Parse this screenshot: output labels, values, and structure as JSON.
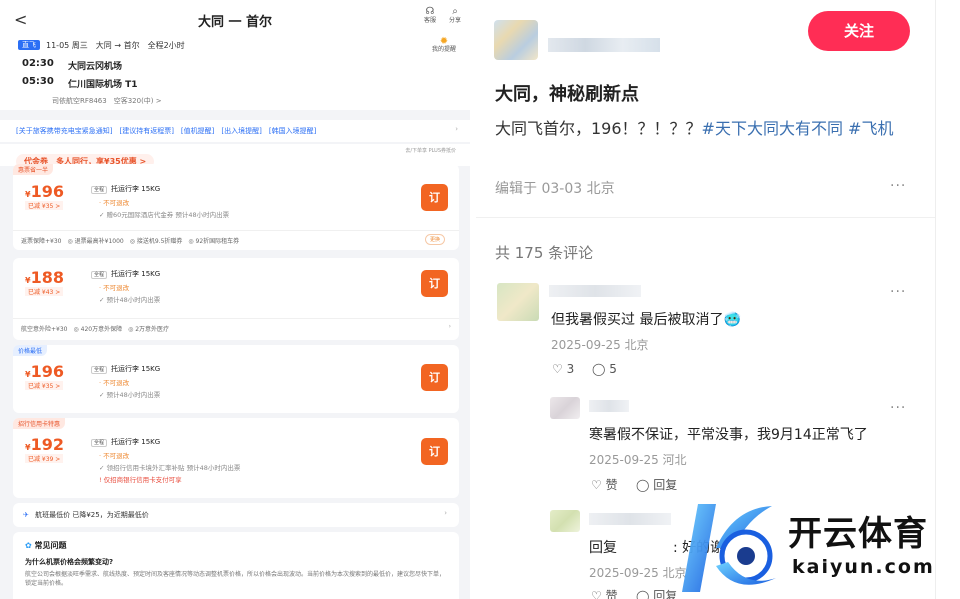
{
  "left": {
    "title": "大同 一 首尔",
    "service_label": "客服",
    "share_label": "分享",
    "flight": {
      "badge": "直飞",
      "date_line": "11-05 周三　大同 → 首尔　全程2小时",
      "dep_time": "02:30",
      "dep_airport": "大同云冈机场",
      "arr_time": "05:30",
      "arr_airport": "仁川国际机场 T1",
      "carrier_line": "司依航空RF8463　空客320(中) >",
      "notice_label": "我的提醒"
    },
    "links": "[关于旅客携带充电宝紧急通知]　[建议持有返程票]　[值机提醒]　[出入境提醒]　[韩国入境提醒]",
    "voucher": "代金券　多人同行，享¥35优惠 >",
    "voucher_side": "去/下单享 PLUS券抵价",
    "cards": [
      {
        "ribbon": "惠票省一半",
        "price": "196",
        "reduced": "已减 ¥35 >",
        "class_pill": "全程",
        "class_text": "托运行李 15KG",
        "lines": [
          "· 不可退改",
          "✓ 赠60元国际酒店代金券 预计48小时内出票"
        ],
        "sub": "返票保障+¥30　◎ 退票最高补¥1000　◎ 接送机9.5折赠券　◎ 92折国际租车券",
        "chip": "更换"
      },
      {
        "ribbon": "",
        "price": "188",
        "reduced": "已减 ¥43 >",
        "class_pill": "全程",
        "class_text": "托运行李 15KG",
        "lines": [
          "· 不可退改",
          "✓ 预计48小时内出票"
        ],
        "sub": "航空意外险+¥30　◎ 420万意外保障　◎ 2万意外医疗",
        "chip": ""
      },
      {
        "ribbon": "价格最低",
        "price": "196",
        "reduced": "已减 ¥35 >",
        "class_pill": "全程",
        "class_text": "托运行李 15KG",
        "lines": [
          "· 不可退改",
          "✓ 预计48小时内出票"
        ],
        "sub": "",
        "chip": ""
      },
      {
        "ribbon": "招行信用卡特惠",
        "price": "192",
        "reduced": "已减 ¥39 >",
        "class_pill": "全程",
        "class_text": "托运行李 15KG",
        "lines": [
          "· 不可退改",
          "✓ 领招行信用卡境外汇率补贴 预计48小时内出票",
          "! 仅招商银行信用卡支付可享"
        ],
        "sub": "",
        "chip": ""
      }
    ],
    "book_label": "订",
    "currency": "¥",
    "low_price": "航班最低价 已降¥25，为近期最低价",
    "faq": {
      "heading": "常见问题",
      "question": "为什么机票价格会频繁变动?",
      "answer": "航空公司会根据淡旺季需求、航线热度、预定时间及客座情况等动态调整机票价格，所以价格会出现波动。当前价格为本次搜索到的最低价，建议您尽快下单，锁定当前价格。"
    }
  },
  "right": {
    "follow_label": "关注",
    "post_title": "大同，神秘刷新点",
    "post_text": "大同飞首尔，196！？！？？",
    "post_tags": "#天下大同大有不同 #飞机",
    "post_meta": "编辑于 03-03 北京",
    "comment_count": "共 175 条评论",
    "comments": [
      {
        "text": "但我暑假买过 最后被取消了🥶",
        "meta": "2025-09-25 北京",
        "likes": "3",
        "replies": "5"
      },
      {
        "text": "寒暑假不保证，平常没事，我9月14正常飞了",
        "meta": "2025-09-25 河北",
        "likes": "赞",
        "replies": "回复"
      },
      {
        "text": "回复　　　　: 好的谢谢",
        "meta": "2025-09-25 北京",
        "likes": "赞",
        "replies": "回复"
      }
    ],
    "more_glyph": "···"
  },
  "watermark": {
    "cn": "开云体育",
    "en": "kaiyun.com"
  }
}
